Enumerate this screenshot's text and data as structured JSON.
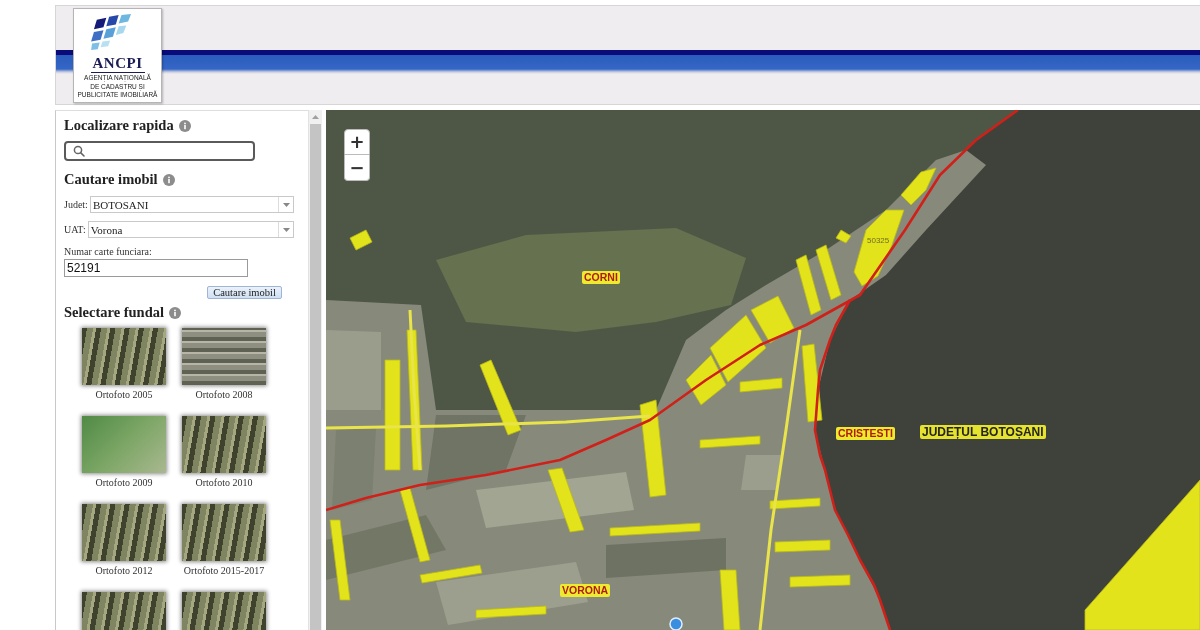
{
  "header": {
    "logo": {
      "name": "ANCPI",
      "subtitle_lines": [
        "AGENȚIA NAȚIONALĂ",
        "DE CADASTRU ȘI",
        "PUBLICITATE IMOBILIARĂ"
      ]
    }
  },
  "sidebar": {
    "quick_locate": {
      "heading": "Localizare rapida"
    },
    "property_search": {
      "heading": "Cautare imobil",
      "fields": [
        {
          "kind": "select",
          "label": "Judet:",
          "value": "BOTOSANI"
        },
        {
          "kind": "select",
          "label": "UAT:",
          "value": "Vorona"
        },
        {
          "kind": "text",
          "label": "Numar carte funciara:",
          "value": "52191"
        }
      ],
      "button": "Cautare imobil"
    },
    "basemap": {
      "heading": "Selectare fundal",
      "options": [
        {
          "kind": "relief",
          "caption": "Ortofoto 2005"
        },
        {
          "kind": "urban",
          "caption": "Ortofoto 2008"
        },
        {
          "kind": "green",
          "caption": "Ortofoto 2009"
        },
        {
          "kind": "relief",
          "caption": "Ortofoto 2010"
        },
        {
          "kind": "relief",
          "caption": "Ortofoto 2012"
        },
        {
          "kind": "relief",
          "caption": "Ortofoto 2015-2017"
        },
        {
          "kind": "relief"
        },
        {
          "kind": "relief"
        }
      ]
    }
  },
  "map": {
    "zoom_controls": [
      "+",
      "−"
    ],
    "labels": [
      {
        "kind": "parcel",
        "text": "50325"
      },
      {
        "kind": "locality",
        "text": "CORNI"
      },
      {
        "kind": "locality",
        "text": "CRISTESTI"
      },
      {
        "kind": "county",
        "text": "JUDEȚUL BOTOȘANI"
      },
      {
        "kind": "locality",
        "text": "VORONA"
      }
    ]
  }
}
